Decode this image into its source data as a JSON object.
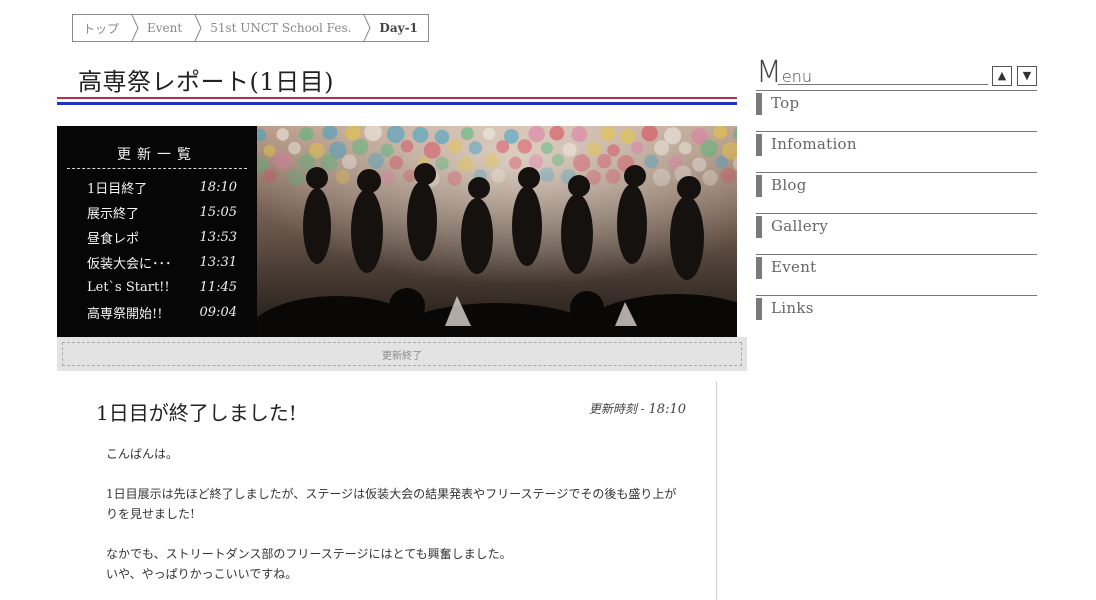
{
  "breadcrumb": [
    {
      "label": "トップ"
    },
    {
      "label": "Event"
    },
    {
      "label": "51st UNCT School Fes."
    },
    {
      "label": "Day-1"
    }
  ],
  "page": {
    "title": "高専祭レポート(1日目)"
  },
  "updates": {
    "heading": "更新一覧",
    "items": [
      {
        "label": "1日目終了",
        "time": "18:10"
      },
      {
        "label": "展示終了",
        "time": "15:05"
      },
      {
        "label": "昼食レポ",
        "time": "13:53"
      },
      {
        "label": "仮装大会に･･･",
        "time": "13:31"
      },
      {
        "label": "Let`s Start!!",
        "time": "11:45"
      },
      {
        "label": "高専祭開始!!",
        "time": "09:04"
      }
    ],
    "status": "更新終了"
  },
  "article": {
    "title": "1日目が終了しました!",
    "time_label": "更新時刻 - ",
    "time_value": "18:10",
    "paragraphs": [
      "こんばんは。",
      "1日目展示は先ほど終了しましたが、ステージは仮装大会の結果発表やフリーステージでその後も盛り上がりを見せました!",
      "なかでも、ストリートダンス部のフリーステージにはとても興奮しました。",
      "いや、やっぱりかっこいいですね。"
    ]
  },
  "menu": {
    "title_first": "M",
    "title_rest": "enu",
    "up_glyph": "▲",
    "down_glyph": "▼",
    "items": [
      {
        "label": "Top"
      },
      {
        "label": "Infomation"
      },
      {
        "label": "Blog"
      },
      {
        "label": "Gallery"
      },
      {
        "label": "Event"
      },
      {
        "label": "Links"
      }
    ]
  },
  "colors": {
    "title_line_red": "#b0334a",
    "title_line_blue": "#2233bb",
    "menu_bar": "#7a7a7a"
  },
  "icons": [
    "chevron-right-icon",
    "arrow-up-icon",
    "arrow-down-icon"
  ]
}
